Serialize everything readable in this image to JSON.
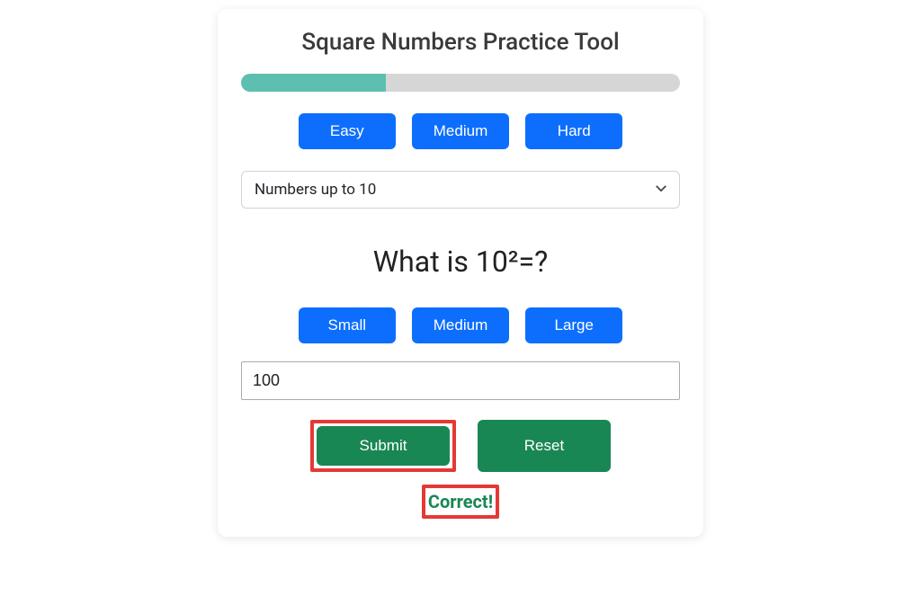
{
  "title": "Square Numbers Practice Tool",
  "progress": {
    "percent": 33
  },
  "difficulty": {
    "easy": "Easy",
    "medium": "Medium",
    "hard": "Hard"
  },
  "range_select": {
    "selected": "Numbers up to 10"
  },
  "question": "What is 10²=?",
  "size": {
    "small": "Small",
    "medium": "Medium",
    "large": "Large"
  },
  "answer": {
    "value": "100"
  },
  "actions": {
    "submit": "Submit",
    "reset": "Reset"
  },
  "feedback": "Correct!",
  "colors": {
    "primary": "#0d6efd",
    "success": "#198754",
    "progress": "#5cbfb0",
    "highlight": "#e53935"
  }
}
